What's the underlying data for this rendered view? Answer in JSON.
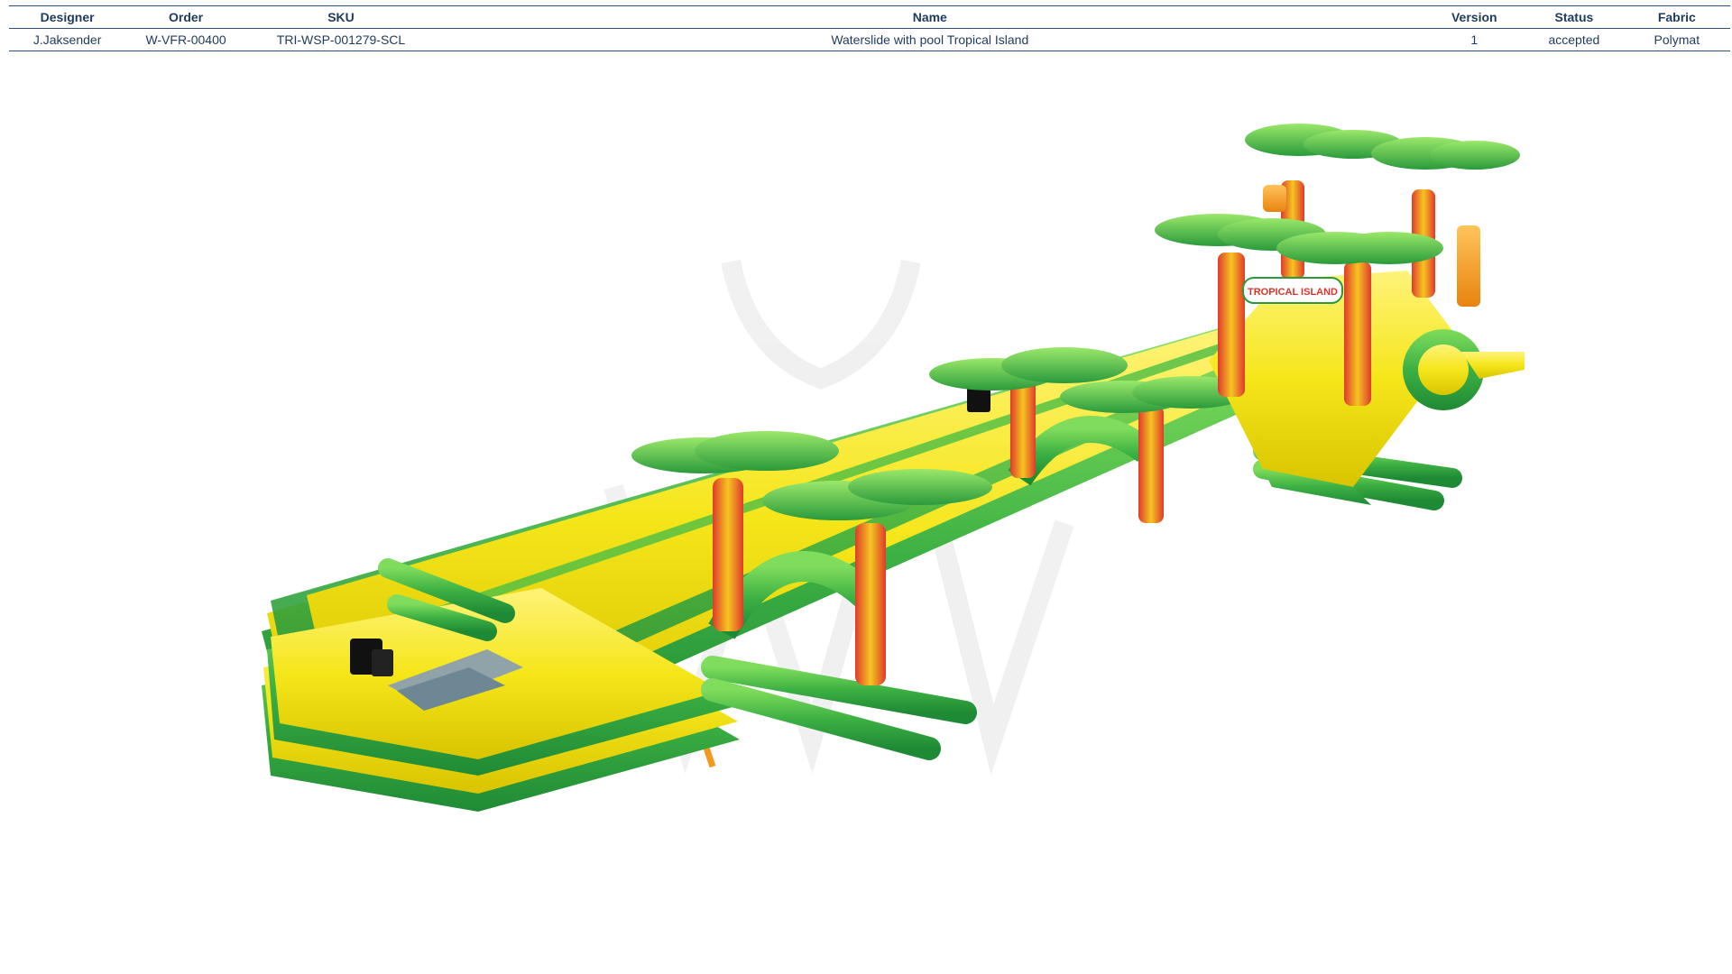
{
  "table": {
    "headers": {
      "designer": "Designer",
      "order": "Order",
      "sku": "SKU",
      "name": "Name",
      "version": "Version",
      "status": "Status",
      "fabric": "Fabric"
    },
    "row": {
      "designer": "J.Jaksender",
      "order": "W-VFR-00400",
      "sku": "TRI-WSP-001279-SCL",
      "name": "Waterslide with pool Tropical Island",
      "version": "1",
      "status": "accepted",
      "fabric": "Polymat"
    }
  },
  "product_banner": {
    "text": "TROPICAL ISLAND"
  },
  "colors": {
    "yellow": "#f5e61a",
    "green": "#3cb043",
    "dark_green": "#1f8a35",
    "orange": "#f39a1e",
    "red": "#d9342b",
    "black": "#111111"
  }
}
